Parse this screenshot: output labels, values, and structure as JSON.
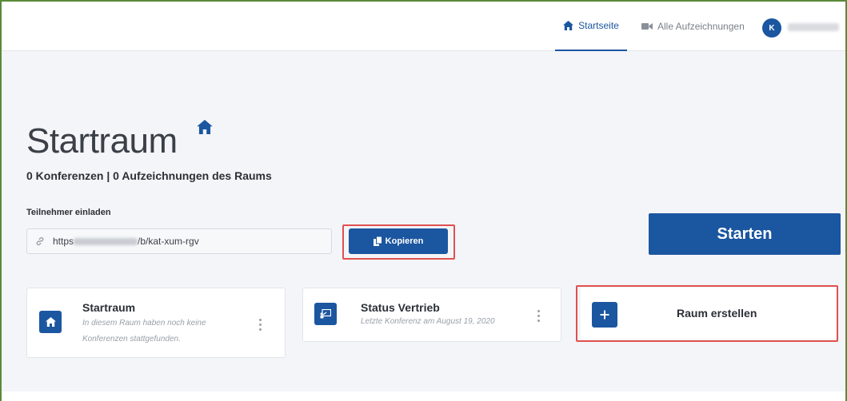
{
  "nav": {
    "home_label": "Startseite",
    "recordings_label": "Alle Aufzeichnungen",
    "avatar_initial": "K"
  },
  "room": {
    "title": "Startraum",
    "stats": "0 Konferenzen | 0 Aufzeichnungen des Raums",
    "invite_label": "Teilnehmer einladen",
    "url_prefix": "https",
    "url_suffix": "/b/kat-xum-rgv",
    "copy_label": "Kopieren",
    "start_label": "Starten"
  },
  "cards": [
    {
      "title": "Startraum",
      "subtitle_line1": "In diesem Raum haben noch keine",
      "subtitle_line2": "Konferenzen stattgefunden.",
      "icon": "home-icon"
    },
    {
      "title": "Status Vertrieb",
      "subtitle_line1": "Letzte Konferenz am August 19, 2020",
      "icon": "presentation-icon"
    }
  ],
  "create_room": {
    "label": "Raum erstellen",
    "icon": "plus-icon"
  },
  "colors": {
    "primary": "#1b56a0",
    "highlight": "#e05050",
    "frame": "#5b8a3a"
  }
}
